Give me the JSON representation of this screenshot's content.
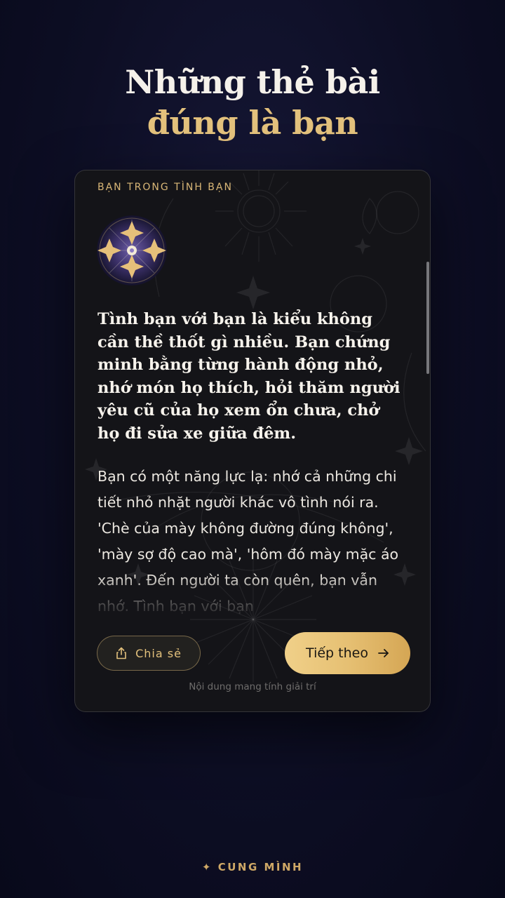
{
  "heading": {
    "line1": "Những thẻ bài",
    "line2": "đúng là bạn"
  },
  "card": {
    "label": "BẠN TRONG TÌNH BẠN",
    "emblem_icon": "tarot-star-emblem-icon",
    "lead": "Tình bạn với bạn là kiểu không cần thề thốt gì nhiều. Bạn chứng minh bằng từng hành động nhỏ, nhớ món họ thích, hỏi thăm người yêu cũ của họ xem ổn chưa, chở họ đi sửa xe giữa đêm.",
    "body": "Bạn có một năng lực lạ: nhớ cả những chi tiết nhỏ nhặt người khác vô tình nói ra. 'Chè của mày không đường đúng không', 'mày sợ độ cao mà', 'hôm đó mày mặc áo xanh'. Đến người ta còn quên, bạn vẫn nhớ. Tình bạn với bạn",
    "share_label": "Chia sẻ",
    "next_label": "Tiếp theo",
    "disclaimer": "Nội dung mang tính giải trí"
  },
  "footer": {
    "brand": "✦ CUNG MÌNH"
  },
  "colors": {
    "background": "#0d0e24",
    "accent_gold": "#e3c17c",
    "card_bg": "#141418"
  }
}
